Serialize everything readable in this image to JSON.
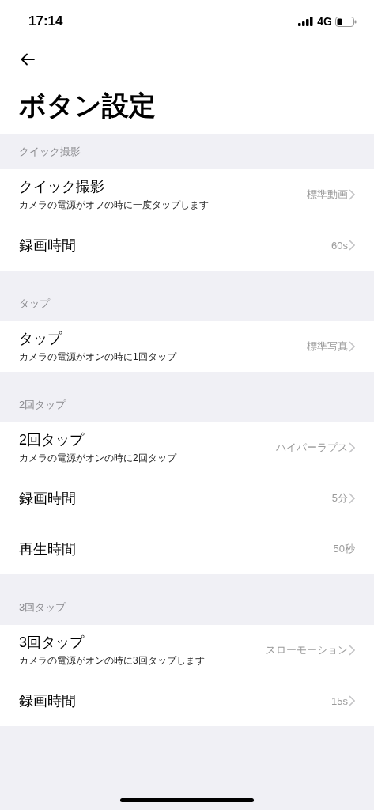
{
  "status_bar": {
    "time": "17:14",
    "network": "4G"
  },
  "title": "ボタン設定",
  "sections": [
    {
      "header": "クイック撮影",
      "rows": [
        {
          "label": "クイック撮影",
          "subtitle": "カメラの電源がオフの時に一度タップします",
          "value": "標準動画",
          "chevron": true
        },
        {
          "label": "録画時間",
          "value": "60s",
          "chevron": true
        }
      ]
    },
    {
      "header": "タップ",
      "rows": [
        {
          "label": "タップ",
          "subtitle": "カメラの電源がオンの時に1回タップ",
          "value": "標準写真",
          "chevron": true
        }
      ]
    },
    {
      "header": "2回タップ",
      "rows": [
        {
          "label": "2回タップ",
          "subtitle": "カメラの電源がオンの時に2回タップ",
          "value": "ハイパーラプス",
          "chevron": true
        },
        {
          "label": "録画時間",
          "value": "5分",
          "chevron": true
        },
        {
          "label": "再生時間",
          "value": "50秒",
          "chevron": false
        }
      ]
    },
    {
      "header": "3回タップ",
      "rows": [
        {
          "label": "3回タップ",
          "subtitle": "カメラの電源がオンの時に3回タップします",
          "value": "スローモーション",
          "chevron": true
        },
        {
          "label": "録画時間",
          "value": "15s",
          "chevron": true
        }
      ]
    }
  ]
}
